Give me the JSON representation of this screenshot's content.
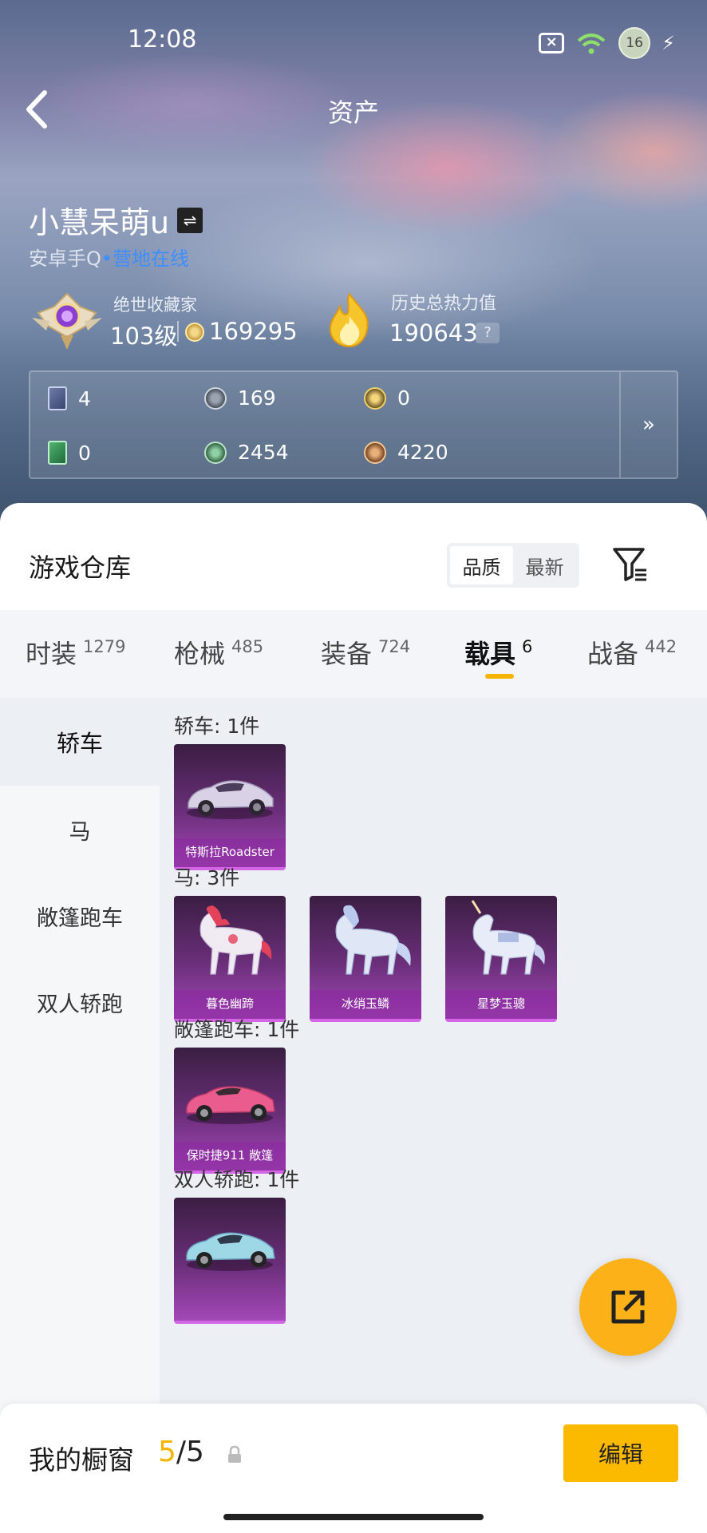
{
  "status_bar": {
    "time": "12:08",
    "battery": "16"
  },
  "header": {
    "title": "资产"
  },
  "profile": {
    "username": "小慧呆萌u",
    "swap_icon": "⇌",
    "platform": "安卓手Q",
    "online_dot": "•",
    "online_status": "营地在线",
    "rank_title": "绝世收藏家",
    "level": "103级",
    "coins": "169295",
    "heat_title": "历史总热力值",
    "heat_value": "190643",
    "help": "?"
  },
  "assets": [
    {
      "icon": "purple-card-icon",
      "value": "4"
    },
    {
      "icon": "silver-coin-icon",
      "value": "169"
    },
    {
      "icon": "gold-emblem-icon",
      "value": "0"
    },
    {
      "icon": "green-card-icon",
      "value": "0"
    },
    {
      "icon": "green-coin-icon",
      "value": "2454"
    },
    {
      "icon": "bronze-coin-icon",
      "value": "4220"
    }
  ],
  "assets_more": "»",
  "warehouse": {
    "title": "游戏仓库",
    "sort_options": [
      "品质",
      "最新"
    ],
    "sort_selected": "品质"
  },
  "tabs": [
    {
      "label": "时装",
      "count": "1279"
    },
    {
      "label": "枪械",
      "count": "485"
    },
    {
      "label": "装备",
      "count": "724"
    },
    {
      "label": "载具",
      "count": "6",
      "active": true
    },
    {
      "label": "战备",
      "count": "442"
    }
  ],
  "side_categories": [
    "轿车",
    "马",
    "敞篷跑车",
    "双人轿跑"
  ],
  "side_selected": "轿车",
  "groups": [
    {
      "title": "轿车: 1件",
      "items": [
        "特斯拉Roadster"
      ]
    },
    {
      "title": "马: 3件",
      "items": [
        "暮色幽蹄",
        "冰绡玉鳞",
        "星梦玉骢"
      ]
    },
    {
      "title": "敞篷跑车: 1件",
      "items": [
        "保时捷911 敞篷"
      ]
    },
    {
      "title": "双人轿跑: 1件",
      "items": [
        ""
      ]
    }
  ],
  "showcase": {
    "label": "我的橱窗",
    "current": "5",
    "separator": "/",
    "total": "5",
    "edit_label": "编辑"
  },
  "colors": {
    "accent": "#fbb900",
    "card_purple": "#a348b8",
    "online_blue": "#3d8fff"
  }
}
